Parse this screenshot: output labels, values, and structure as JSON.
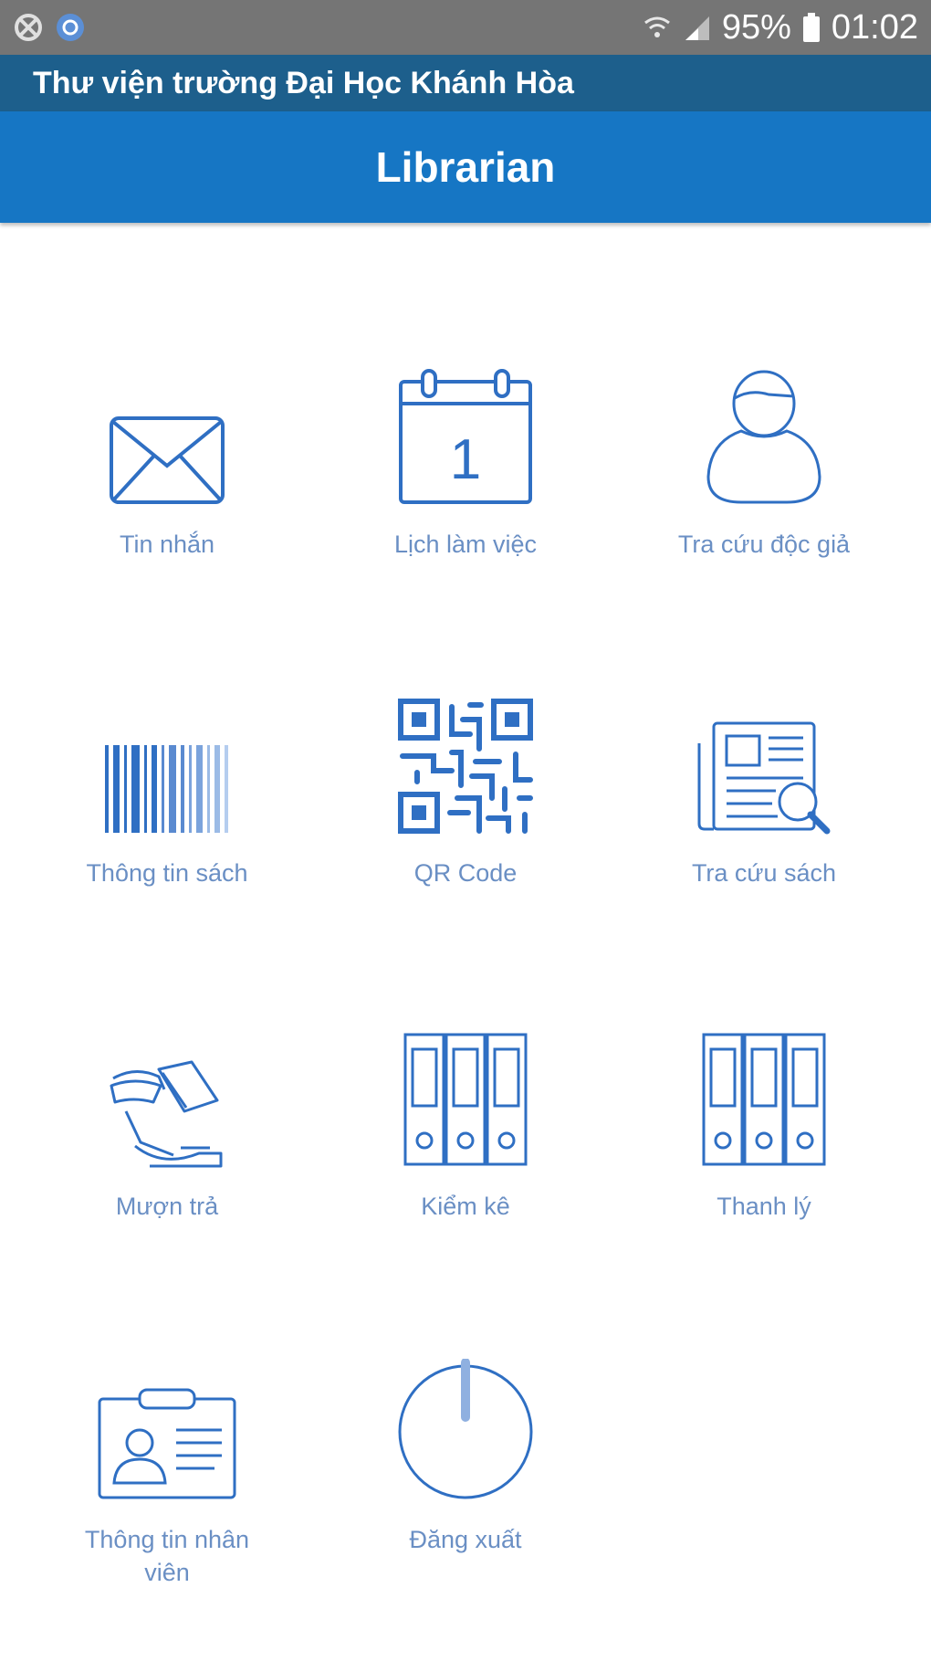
{
  "status_bar": {
    "battery": "95%",
    "time": "01:02",
    "icons": [
      "blocked-icon",
      "sync-icon",
      "wifi-icon",
      "signal-icon",
      "battery-icon"
    ]
  },
  "app": {
    "titlebar": "Thư viện trường Đại Học Khánh Hòa",
    "header_title": "Librarian"
  },
  "colors": {
    "status_bar": "#757575",
    "titlebar": "#1d5f8c",
    "header": "#1676c4",
    "icon_stroke": "#2f6fc3",
    "label": "#6a8fc4"
  },
  "menu": {
    "items": [
      {
        "label": "Tin nhắn",
        "icon": "envelope-icon"
      },
      {
        "label": "Lịch làm việc",
        "icon": "calendar-icon",
        "calendar_day": "1"
      },
      {
        "label": "Tra cứu độc giả",
        "icon": "reader-icon"
      },
      {
        "label": "Thông tin sách",
        "icon": "barcode-icon"
      },
      {
        "label": "QR Code",
        "icon": "qr-code-icon"
      },
      {
        "label": "Tra cứu sách",
        "icon": "newspaper-search-icon"
      },
      {
        "label": "Mượn trả",
        "icon": "book-exchange-icon"
      },
      {
        "label": "Kiểm kê",
        "icon": "binders-icon"
      },
      {
        "label": "Thanh lý",
        "icon": "binders-icon"
      },
      {
        "label": "Thông tin nhân viên",
        "icon": "id-card-icon"
      },
      {
        "label": "Đăng xuất",
        "icon": "power-icon"
      }
    ]
  }
}
